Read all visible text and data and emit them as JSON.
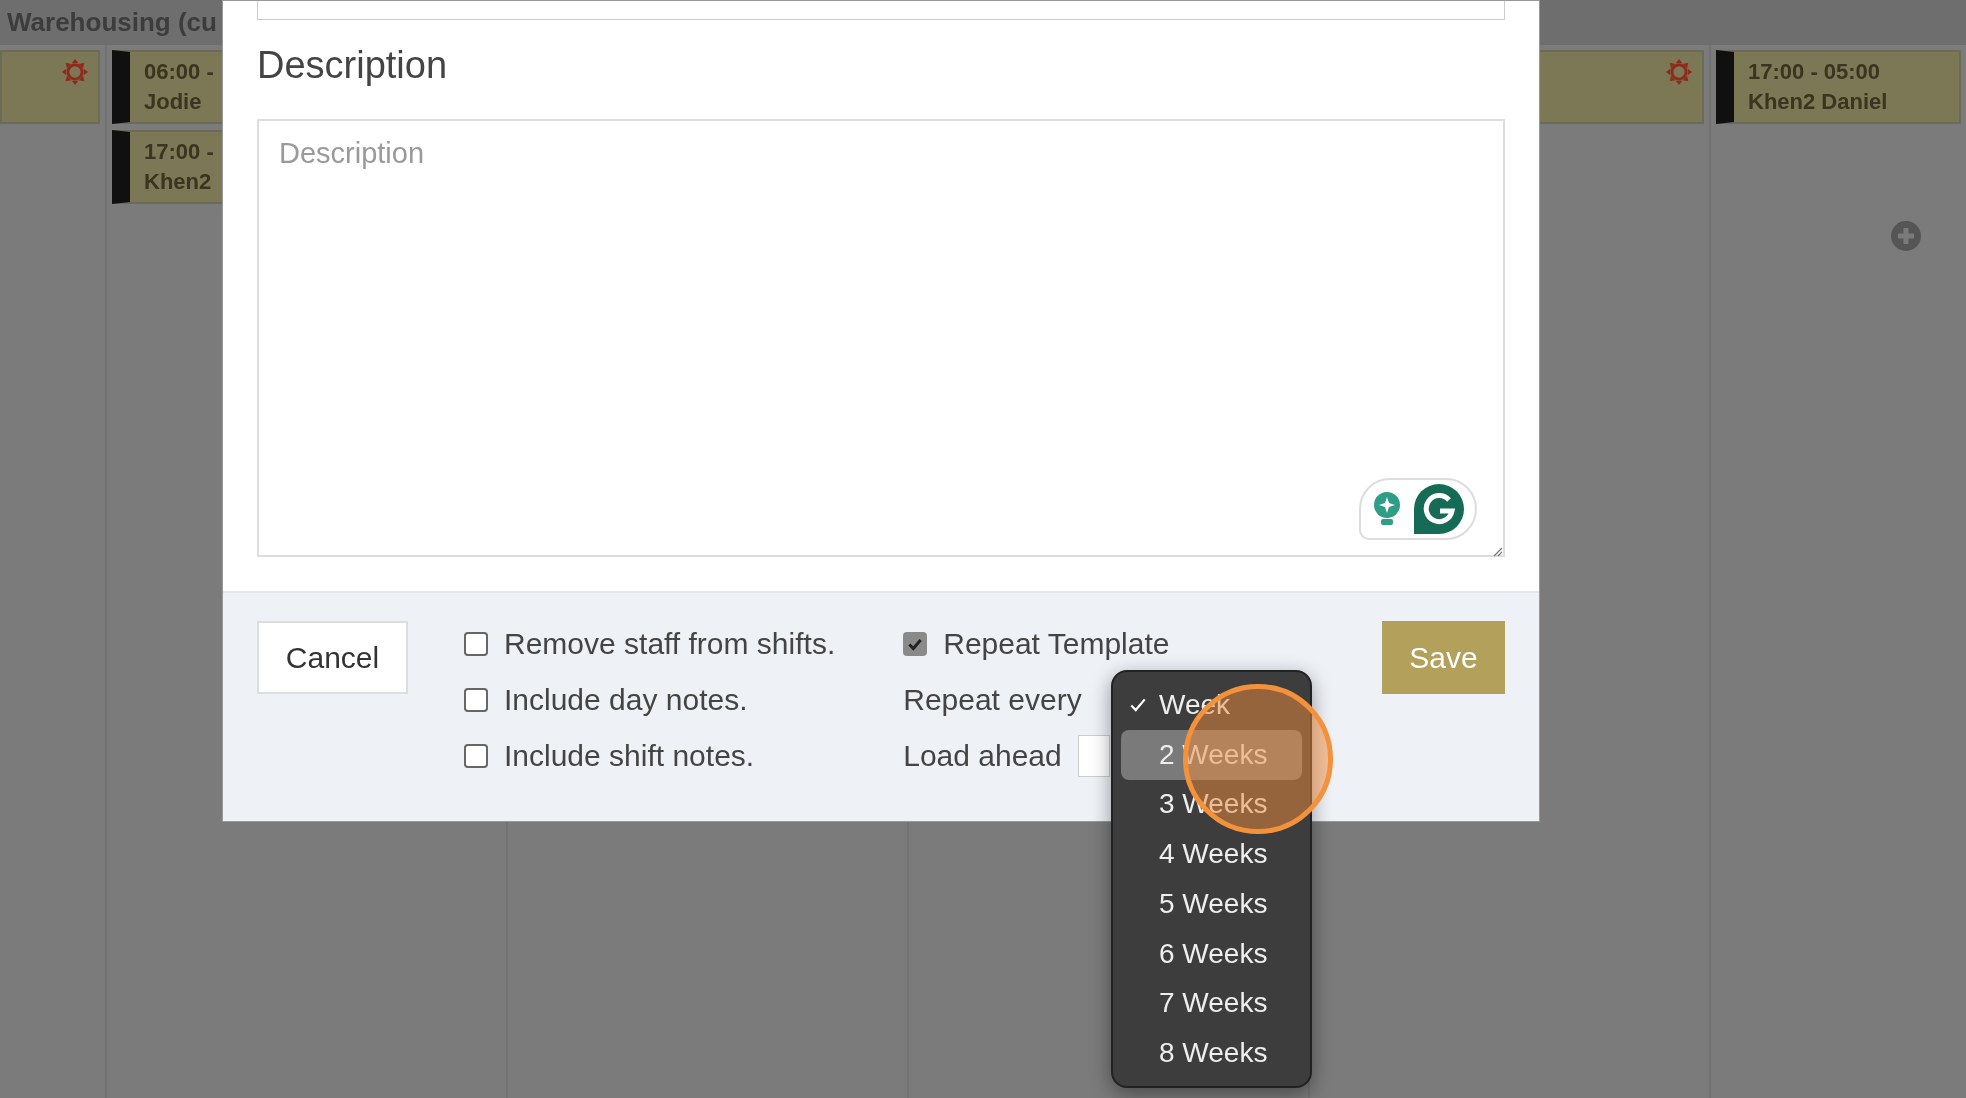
{
  "header": {
    "title": "Warehousing (cu"
  },
  "calendar": {
    "columns": [
      {
        "cards": [
          {
            "kind": "day"
          }
        ]
      },
      {
        "cards": [
          {
            "kind": "shift",
            "time": "06:00 -",
            "name": "Jodie"
          },
          {
            "kind": "shift",
            "time": "17:00 -",
            "name": "Khen2"
          }
        ]
      },
      {},
      {},
      {
        "cards": [
          {
            "kind": "day"
          }
        ]
      },
      {
        "cards": [
          {
            "kind": "shift",
            "time": "17:00 - 05:00",
            "name": "Khen2 Daniel"
          }
        ],
        "add_button": true
      }
    ]
  },
  "dialog": {
    "description": {
      "heading": "Description",
      "placeholder": "Description"
    },
    "cancel": "Cancel",
    "options": [
      {
        "label": "Remove staff from shifts.",
        "checked": false
      },
      {
        "label": "Include day notes.",
        "checked": false
      },
      {
        "label": "Include shift notes.",
        "checked": false
      }
    ],
    "repeat": {
      "label": "Repeat Template",
      "checked": true
    },
    "repeat_every": {
      "label": "Repeat every",
      "menu": [
        {
          "label": "Week",
          "selected": true,
          "highlighted": false
        },
        {
          "label": "2 Weeks",
          "selected": false,
          "highlighted": true
        },
        {
          "label": "3 Weeks",
          "selected": false,
          "highlighted": false
        },
        {
          "label": "4 Weeks",
          "selected": false,
          "highlighted": false
        },
        {
          "label": "5 Weeks",
          "selected": false,
          "highlighted": false
        },
        {
          "label": "6 Weeks",
          "selected": false,
          "highlighted": false
        },
        {
          "label": "7 Weeks",
          "selected": false,
          "highlighted": false
        },
        {
          "label": "8 Weeks",
          "selected": false,
          "highlighted": false
        }
      ]
    },
    "load_ahead": {
      "label": "Load ahead"
    },
    "save": "Save"
  }
}
